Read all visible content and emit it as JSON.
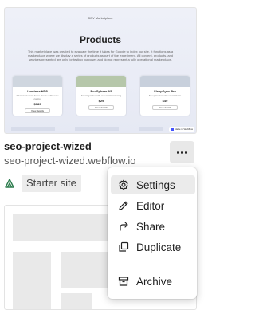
{
  "site": {
    "name": "seo-project-wized",
    "url": "seo-project-wized.webflow.io",
    "plan": "Starter site",
    "more_label": "..."
  },
  "thumbnail": {
    "brand": "DEV Marketplace",
    "title": "Products",
    "description": "This marketplace was created to evaluate the time it takes for Google to index our site. It functions as a marketplace where we display a series of products as part of the experiment. All content, products, and services presented are only for testing purposes and do not represent a fully operational marketplace.",
    "products": [
      {
        "name": "Luminex HD5",
        "desc": "Advanced smart home device with voice control",
        "price": "$189",
        "button": "View details"
      },
      {
        "name": "EcoSphere A5",
        "desc": "Smart garden with automatic watering",
        "price": "$29",
        "button": "View details"
      },
      {
        "name": "SleepSync Pro",
        "desc": "Sleep tracker with smart alarm",
        "price": "$49",
        "button": "View details"
      }
    ],
    "badge": "Made in Webflow"
  },
  "menu": {
    "items": [
      {
        "label": "Settings",
        "icon": "gear-icon"
      },
      {
        "label": "Editor",
        "icon": "pencil-icon"
      },
      {
        "label": "Share",
        "icon": "share-arrow-icon"
      },
      {
        "label": "Duplicate",
        "icon": "duplicate-icon"
      },
      {
        "label": "Archive",
        "icon": "archive-box-icon"
      }
    ],
    "hovered": "Settings"
  },
  "colors": {
    "plan_icon": "#2e7d4f",
    "menu_hover": "#ebebeb",
    "webflow_blue": "#4353ff"
  }
}
